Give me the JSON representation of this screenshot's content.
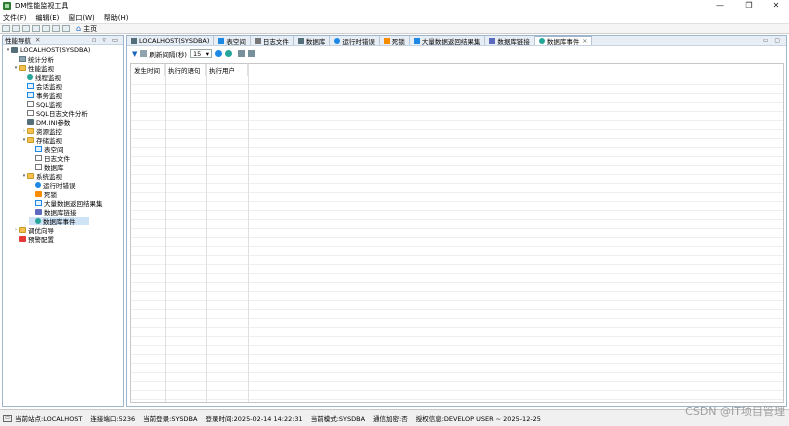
{
  "window": {
    "title": "DM性能监视工具",
    "controls": [
      "—",
      "❐",
      "✕"
    ]
  },
  "menu": [
    "文件(F)",
    "编辑(E)",
    "窗口(W)",
    "帮助(H)"
  ],
  "toolbar": {
    "home_label": "主页"
  },
  "nav": {
    "title": "性能导航",
    "tab_close": "✕",
    "tree": {
      "root": "LOCALHOST(SYSDBA)",
      "stats": "统计分析",
      "perf_monitor": "性能监视",
      "thread_monitor": "线程监视",
      "session_monitor": "会话监视",
      "txn_monitor": "事务监视",
      "sql_monitor": "SQL监视",
      "sql_log": "SQL日志文件分析",
      "ini_params": "DM.INI参数",
      "resource_monitor": "资源监控",
      "storage_monitor": "存储监视",
      "tablespace": "表空间",
      "logfile": "日志文件",
      "database": "数据库",
      "system_monitor": "系统监视",
      "running_errors": "运行时错误",
      "deadlock": "死锁",
      "large_result": "大量数据返回结果集",
      "db_links": "数据库链接",
      "db_events": "数据库事件",
      "tuning_wizard": "调优向导",
      "alert_config": "预警配置"
    }
  },
  "tabs": [
    {
      "label": "LOCALHOST(SYSDBA)",
      "icon": "server-icon",
      "color": "#546e7a"
    },
    {
      "label": "表空间",
      "icon": "tablespace-icon",
      "color": "#1e88e5"
    },
    {
      "label": "日志文件",
      "icon": "logfile-icon",
      "color": "#777777"
    },
    {
      "label": "数据库",
      "icon": "database-icon",
      "color": "#546e7a"
    },
    {
      "label": "运行时错误",
      "icon": "error-icon",
      "color": "#1e88e5"
    },
    {
      "label": "死锁",
      "icon": "lock-icon",
      "color": "#fb8c00"
    },
    {
      "label": "大量数据返回结果集",
      "icon": "resultset-icon",
      "color": "#1e88e5"
    },
    {
      "label": "数据库链接",
      "icon": "link-icon",
      "color": "#5c6bc0"
    },
    {
      "label": "数据库事件",
      "icon": "event-icon",
      "color": "#26a69a"
    }
  ],
  "editor_toolbar": {
    "refresh_label": "刷新间隔(秒)",
    "refresh_value": "15"
  },
  "table": {
    "columns": [
      "发生时间",
      "执行的语句",
      "执行用户"
    ]
  },
  "status": {
    "site": "当前站点:LOCALHOST",
    "port": "连接端口:5236",
    "login": "当前登录:SYSDBA",
    "login_time": "登录时间:2025-02-14 14:22:31",
    "mode": "当前模式:SYSDBA",
    "encrypt": "通信加密:否",
    "license": "授权信息:DEVELOP USER ~ 2025-12-25"
  },
  "watermark": "CSDN @IT项目管理"
}
